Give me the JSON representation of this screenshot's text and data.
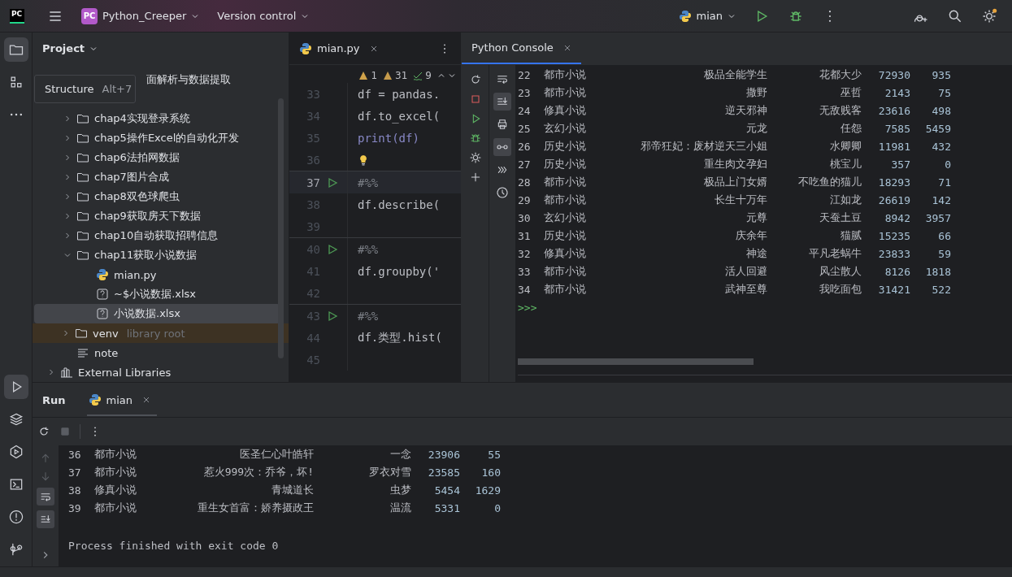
{
  "topbar": {
    "logo": "PC",
    "project_badge": "PC",
    "project": "Python_Creeper",
    "vcs": "Version control",
    "run_config": "mian"
  },
  "left_strip": {
    "top": [
      {
        "selected": true
      },
      {
        "selected": false
      },
      {
        "selected": false
      }
    ],
    "bottom": [
      {
        "selected": true
      },
      {
        "selected": false
      },
      {
        "selected": false
      },
      {
        "selected": false
      },
      {
        "selected": false
      },
      {
        "selected": false
      }
    ]
  },
  "project": {
    "title": "Project",
    "tooltip": {
      "label": "Structure",
      "shortcut": "Alt+7"
    },
    "tree": [
      {
        "label": "面解析与数据提取",
        "kind": "partial",
        "selected": false
      },
      {
        "label": "chap4实现登录系统",
        "kind": "folder",
        "expanded": false,
        "selected": false
      },
      {
        "label": "chap5操作Excel的自动化开发",
        "kind": "folder",
        "expanded": false,
        "selected": false
      },
      {
        "label": "chap6法拍网数据",
        "kind": "folder",
        "expanded": false,
        "selected": false
      },
      {
        "label": "chap7图片合成",
        "kind": "folder",
        "expanded": false,
        "selected": false
      },
      {
        "label": "chap8双色球爬虫",
        "kind": "folder",
        "expanded": false,
        "selected": false
      },
      {
        "label": "chap9获取房天下数据",
        "kind": "folder",
        "expanded": false,
        "selected": false
      },
      {
        "label": "chap10自动获取招聘信息",
        "kind": "folder",
        "expanded": false,
        "selected": false
      },
      {
        "label": "chap11获取小说数据",
        "kind": "folder",
        "expanded": true,
        "selected": false,
        "children": [
          {
            "label": "mian.py",
            "kind": "python",
            "selected": false
          },
          {
            "label": "~$小说数据.xlsx",
            "kind": "unknown",
            "selected": false
          },
          {
            "label": "小说数据.xlsx",
            "kind": "unknown",
            "selected": true
          }
        ]
      },
      {
        "label": "venv",
        "suffix": "library root",
        "kind": "folder",
        "expanded": false,
        "selected": false,
        "library": true
      },
      {
        "label": "note",
        "kind": "text",
        "selected": false
      }
    ],
    "external": {
      "label": "External Libraries",
      "expanded": false
    }
  },
  "editor": {
    "tab": "mian.py",
    "inspections": {
      "errors": "1",
      "warnings": "31",
      "typos": "9"
    },
    "lines": [
      {
        "no": "33",
        "code": "df = pandas.",
        "kind": "code",
        "run": false,
        "current": false
      },
      {
        "no": "34",
        "code": "df.to_excel(",
        "kind": "code",
        "run": false,
        "current": false
      },
      {
        "no": "35",
        "code": "print(df)",
        "kind": "builtin",
        "run": false,
        "current": false
      },
      {
        "no": "36",
        "kind": "bulb",
        "run": false,
        "current": false
      },
      {
        "no": "37",
        "code": "#%%",
        "kind": "cell",
        "run": true,
        "current": true
      },
      {
        "no": "38",
        "code": "df.describe(",
        "kind": "code",
        "run": false,
        "current": false
      },
      {
        "no": "39",
        "kind": "blank",
        "run": false,
        "current": false
      },
      {
        "no": "40",
        "code": "#%%",
        "kind": "cell",
        "run": true,
        "current": false
      },
      {
        "no": "41",
        "code": "df.groupby('",
        "kind": "code",
        "run": false,
        "current": false
      },
      {
        "no": "42",
        "kind": "blank",
        "run": false,
        "current": false
      },
      {
        "no": "43",
        "code": "#%%",
        "kind": "cell",
        "run": true,
        "current": false
      },
      {
        "no": "44",
        "code": "df.类型.hist(",
        "kind": "code",
        "run": false,
        "current": false
      },
      {
        "no": "45",
        "kind": "blank",
        "run": false,
        "current": false
      }
    ]
  },
  "console": {
    "tab": "Python Console",
    "tools_b": [
      {
        "selected": false
      },
      {
        "selected": true
      },
      {
        "selected": false
      },
      {
        "selected": true
      },
      {
        "selected": false
      },
      {
        "selected": false
      }
    ],
    "rows": [
      [
        "22",
        "都市小说",
        "极品全能学生",
        "花都大少",
        "72930",
        "935"
      ],
      [
        "23",
        "都市小说",
        "撒野",
        "巫哲",
        "2143",
        "75"
      ],
      [
        "24",
        "修真小说",
        "逆天邪神",
        "无敌贱客",
        "23616",
        "498"
      ],
      [
        "25",
        "玄幻小说",
        "元龙",
        "任怨",
        "7585",
        "5459"
      ],
      [
        "26",
        "历史小说",
        "邪帝狂妃：废材逆天三小姐",
        "水卿卿",
        "11981",
        "432"
      ],
      [
        "27",
        "历史小说",
        "重生肉文孕妇",
        "桃宝儿",
        "357",
        "0"
      ],
      [
        "28",
        "都市小说",
        "极品上门女婿",
        "不吃鱼的猫儿",
        "18293",
        "71"
      ],
      [
        "29",
        "都市小说",
        "长生十万年",
        "江如龙",
        "26619",
        "142"
      ],
      [
        "30",
        "玄幻小说",
        "元尊",
        "天蚕土豆",
        "8942",
        "3957"
      ],
      [
        "31",
        "历史小说",
        "庆余年",
        "猫腻",
        "15235",
        "66"
      ],
      [
        "32",
        "修真小说",
        "神途",
        "平凡老蜗牛",
        "23833",
        "59"
      ],
      [
        "33",
        "都市小说",
        "活人回避",
        "风尘散人",
        "8126",
        "1818"
      ],
      [
        "34",
        "都市小说",
        "武神至尊",
        "我吃面包",
        "31421",
        "522"
      ]
    ],
    "prompt": ">>>"
  },
  "run": {
    "title": "Run",
    "tab": "mian",
    "rows": [
      [
        "36",
        "都市小说",
        "医圣仁心叶皓轩",
        "一念",
        "23906",
        "55"
      ],
      [
        "37",
        "都市小说",
        "惹火999次：乔爷，坏!",
        "罗衣对雪",
        "23585",
        "160"
      ],
      [
        "38",
        "修真小说",
        "青城道长",
        "虫梦",
        "5454",
        "1629"
      ],
      [
        "39",
        "都市小说",
        "重生女首富：娇养摄政王",
        "温流",
        "5331",
        "0"
      ]
    ],
    "exit": "Process finished with exit code 0"
  }
}
